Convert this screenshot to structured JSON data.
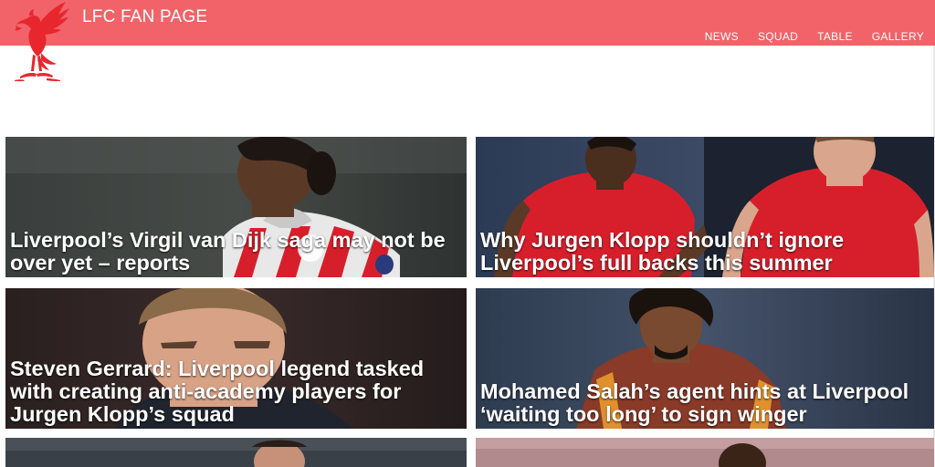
{
  "header": {
    "brand": "LFC FAN PAGE",
    "logo_icon": "liverbird-icon",
    "bar_color": "#f16368",
    "logo_color": "#e8262d",
    "nav": [
      {
        "label": "NEWS"
      },
      {
        "label": "SQUAD"
      },
      {
        "label": "TABLE"
      },
      {
        "label": "GALLERY"
      }
    ]
  },
  "articles": [
    {
      "title": "Liverpool’s Virgil van Dijk saga may not be over yet – reports"
    },
    {
      "title": "Why Jurgen Klopp shouldn’t ignore Liverpool’s full backs this summer"
    },
    {
      "title": "Steven Gerrard: Liverpool legend tasked with creating anti-academy players for Jurgen Klopp’s squad"
    },
    {
      "title": "Mohamed Salah’s agent hints at Liverpool ‘waiting too long’ to sign winger"
    },
    {
      "title": ""
    },
    {
      "title": ""
    }
  ]
}
